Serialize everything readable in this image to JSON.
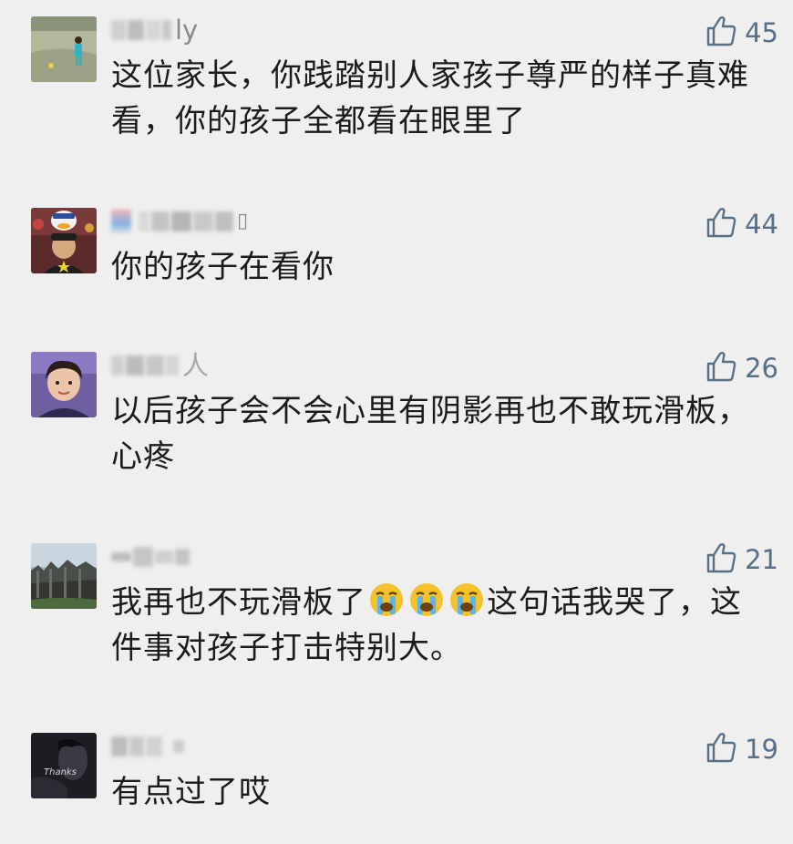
{
  "comments": [
    {
      "name_visible": "ly",
      "likes": "45",
      "text": "这位家长，你践踏别人家孩子尊严的样子真难看，你的孩子全都看在眼里了",
      "avatar": "child-on-grass-photo"
    },
    {
      "name_visible": "▯",
      "likes": "44",
      "text": "你的孩子在看你",
      "avatar": "kid-with-donald-duck-photo"
    },
    {
      "name_visible": "人",
      "likes": "26",
      "text": "以后孩子会不会心里有阴影再也不敢玩滑板，心疼",
      "avatar": "woman-portrait-photo"
    },
    {
      "name_visible": "",
      "likes": "21",
      "text_before": "我再也不玩滑板了",
      "text_after": "这句话我哭了，这件事对孩子打击特别大。",
      "emoji_name": "crying-face-emoji",
      "avatar": "rocky-landscape-photo"
    },
    {
      "name_visible": "",
      "likes": "19",
      "text": "有点过了哎",
      "avatar": "dark-thanks-photo",
      "avatar_caption": "Thanks"
    }
  ],
  "icons": {
    "like": "thumbs-up-outline-icon"
  },
  "colors": {
    "background": "#efefef",
    "like_icon": "#5a6f86",
    "name_gray": "#8a8a8a"
  }
}
